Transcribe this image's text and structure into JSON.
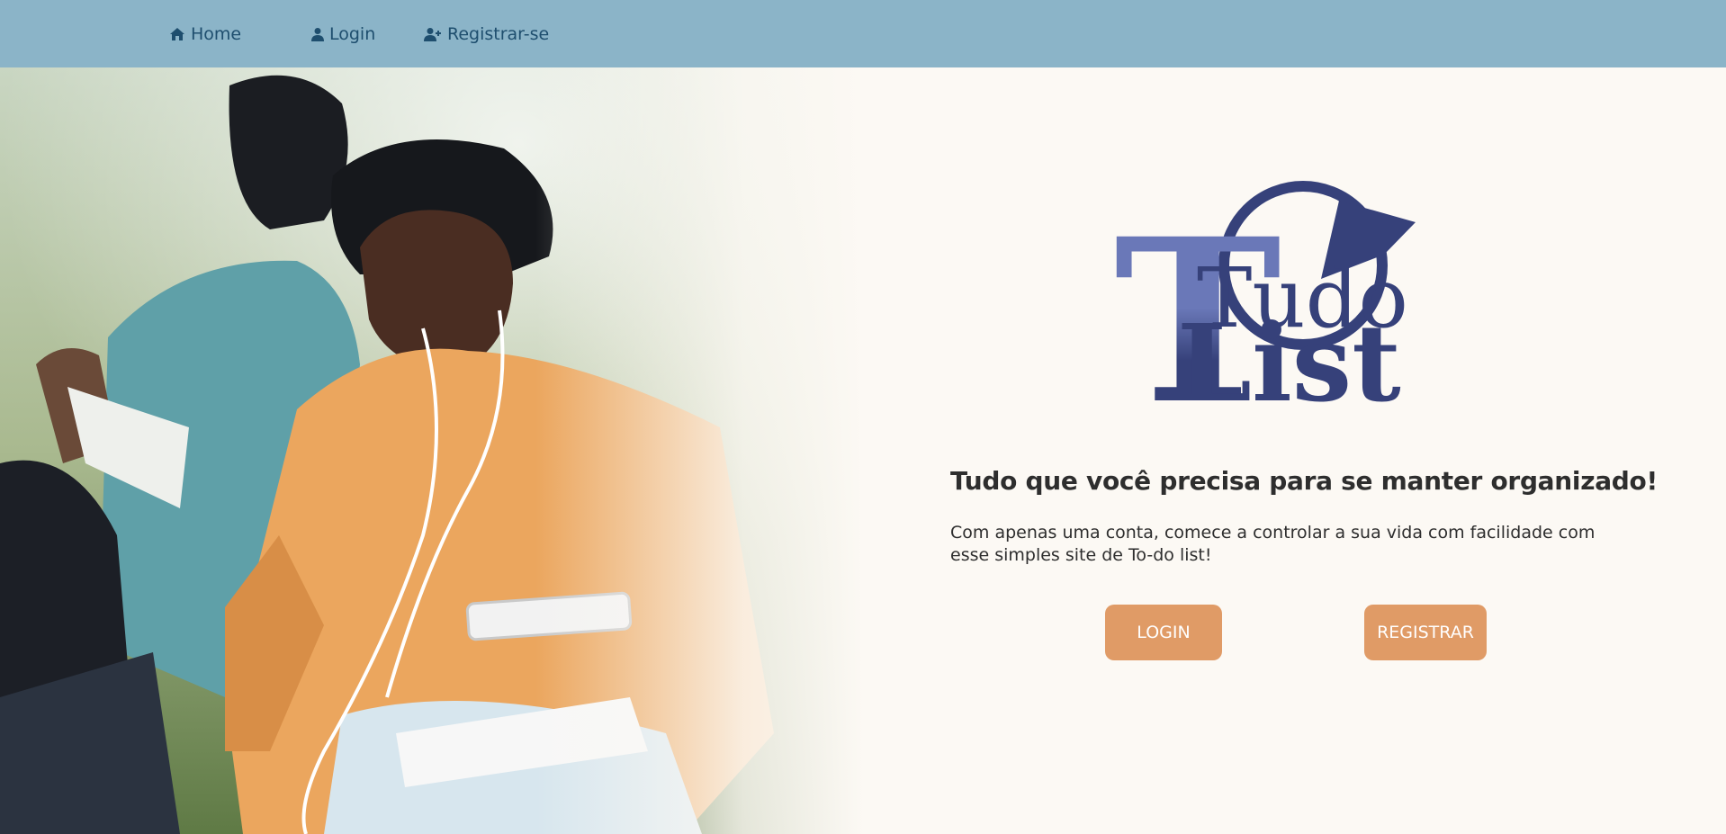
{
  "nav": {
    "items": [
      {
        "label": "Home",
        "icon": "home-icon"
      },
      {
        "label": "Login",
        "icon": "user-icon"
      },
      {
        "label": "Registrar-se",
        "icon": "user-plus-icon"
      }
    ]
  },
  "hero": {
    "image_alt": "Two students sitting on the grass, one in an orange sweater holding a phone with earphones",
    "logo_text": {
      "line1": "Tudo",
      "line2": "List"
    }
  },
  "main": {
    "headline": "Tudo que você precisa para se manter organizado!",
    "description": "Com apenas uma conta, comece a controlar a sua vida com facilidade com esse simples site de To-do list!",
    "login_button": "LOGIN",
    "register_button": "REGISTRAR"
  },
  "colors": {
    "topbar": "#8bb4c8",
    "nav_text": "#1e4e6e",
    "background": "#fcf9f4",
    "button": "#e09b66",
    "logo_primary": "#36417a",
    "logo_light": "#6a78b8"
  }
}
